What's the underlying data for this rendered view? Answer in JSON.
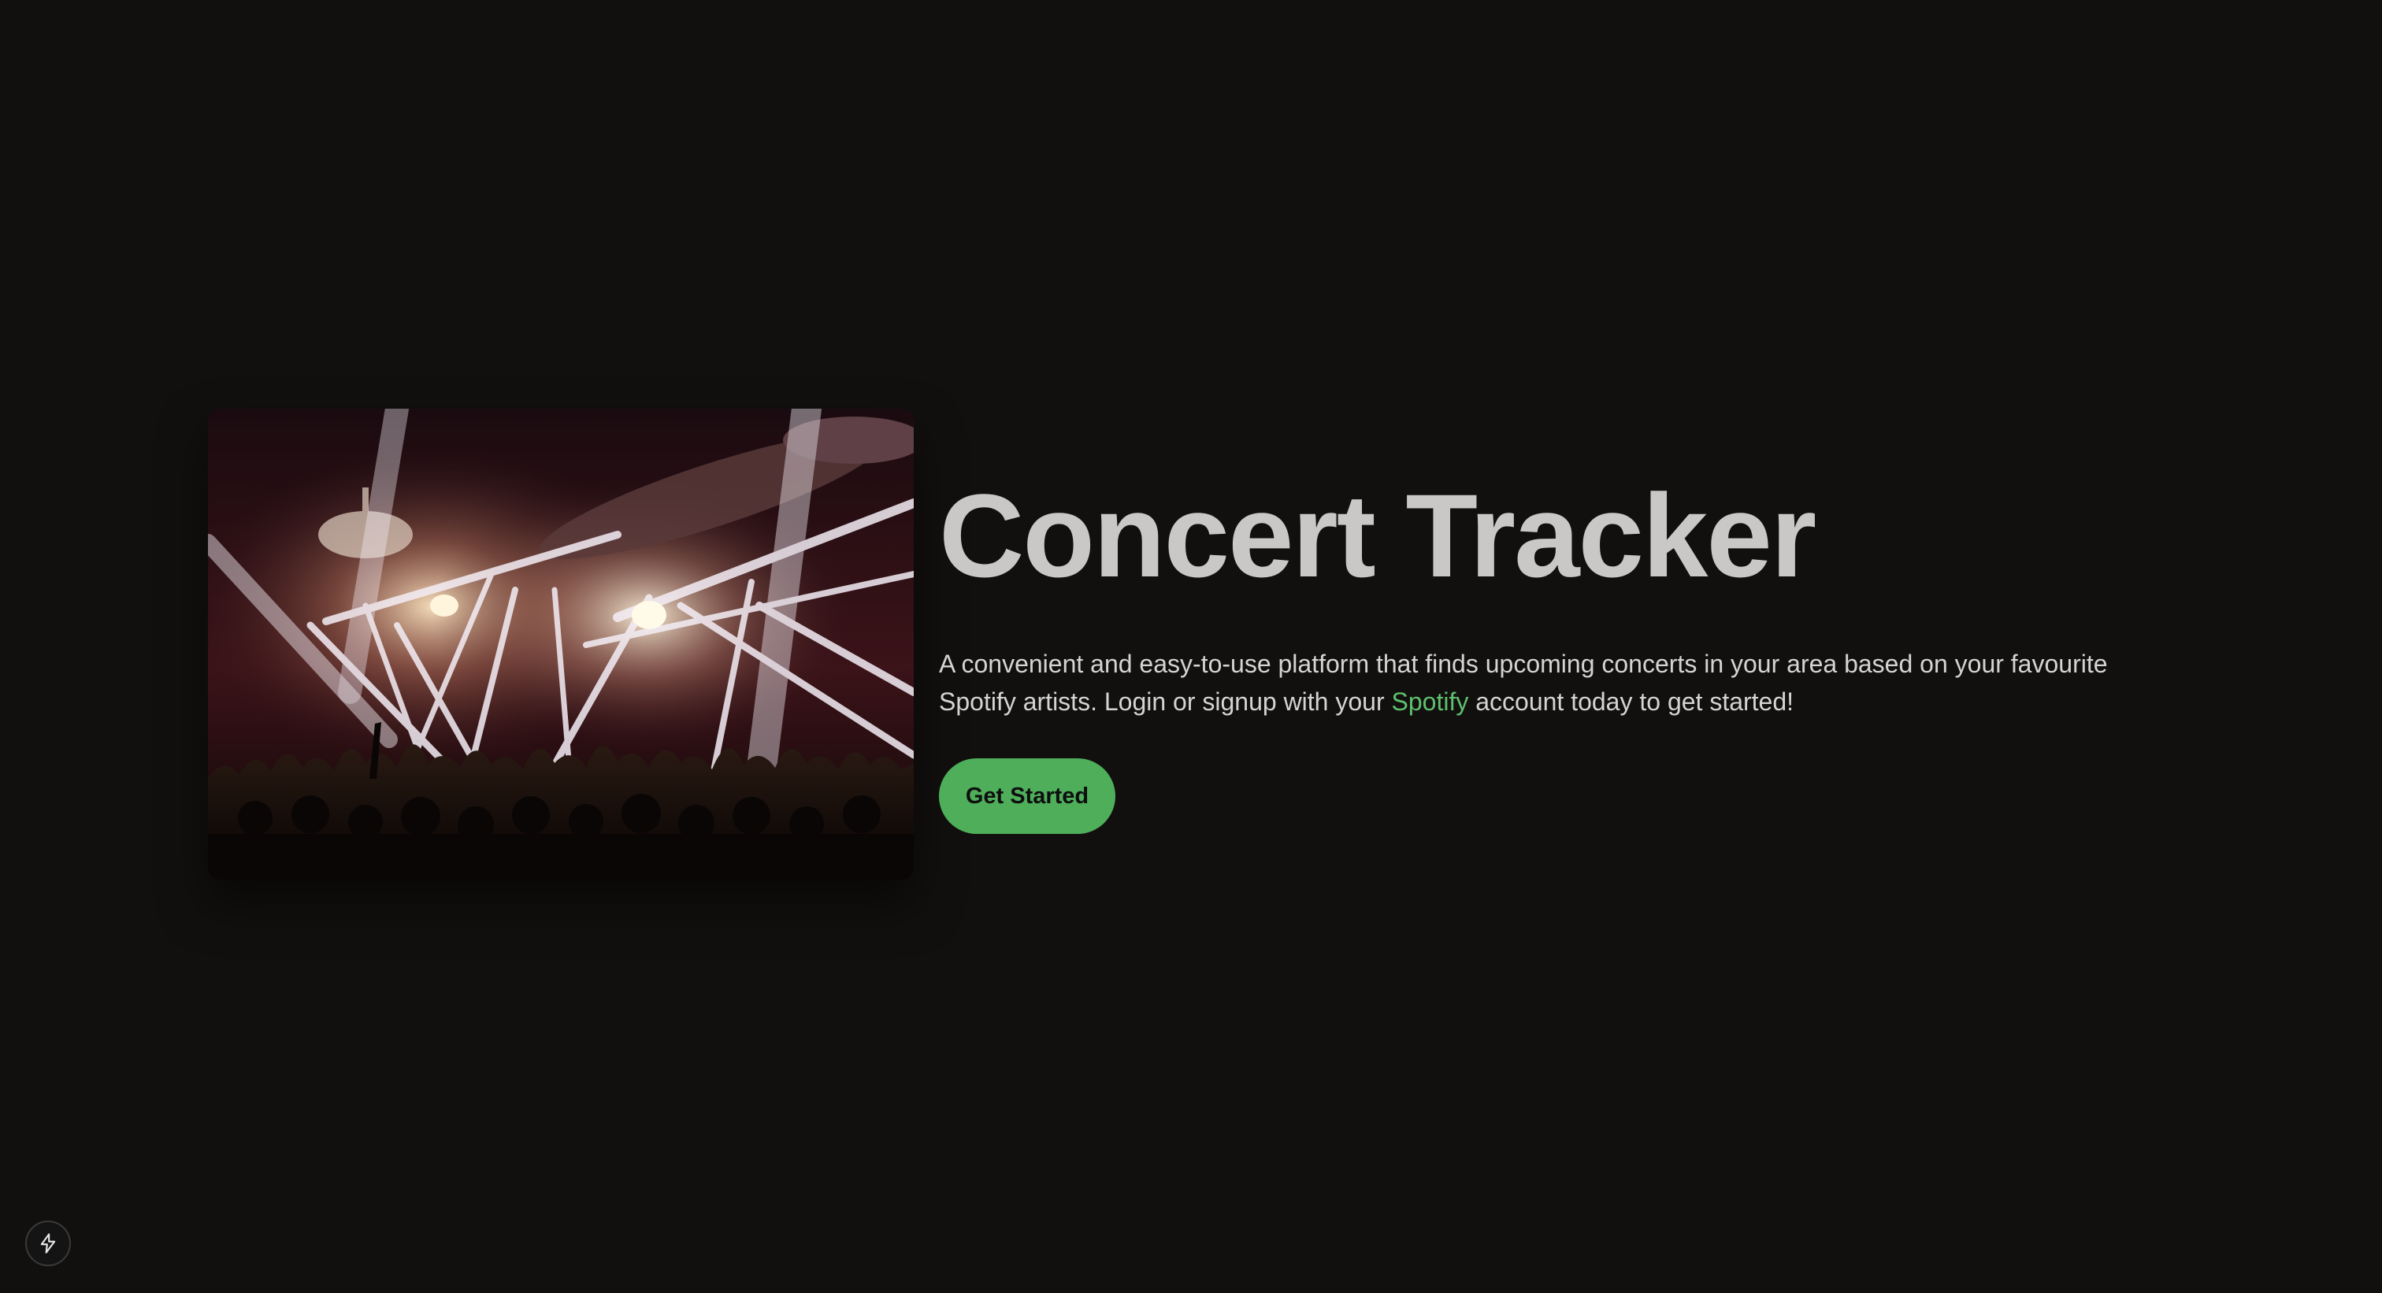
{
  "hero": {
    "image_alt": "Concert crowd under stage lights",
    "title": "Concert Tracker",
    "description_line1": "A convenient and easy-to-use platform that finds upcoming concerts in your area based on your favourite",
    "description_line2_before": "Spotify artists. Login or signup with your ",
    "description_link": "Spotify",
    "description_line2_after": " account today to get started!",
    "cta_label": "Get Started"
  },
  "colors": {
    "background": "#12100f",
    "title": "#c9c8c6",
    "accent": "#5ec06d",
    "button": "#4eae5a"
  },
  "dev_indicator": {
    "icon": "lightning-bolt-icon"
  }
}
